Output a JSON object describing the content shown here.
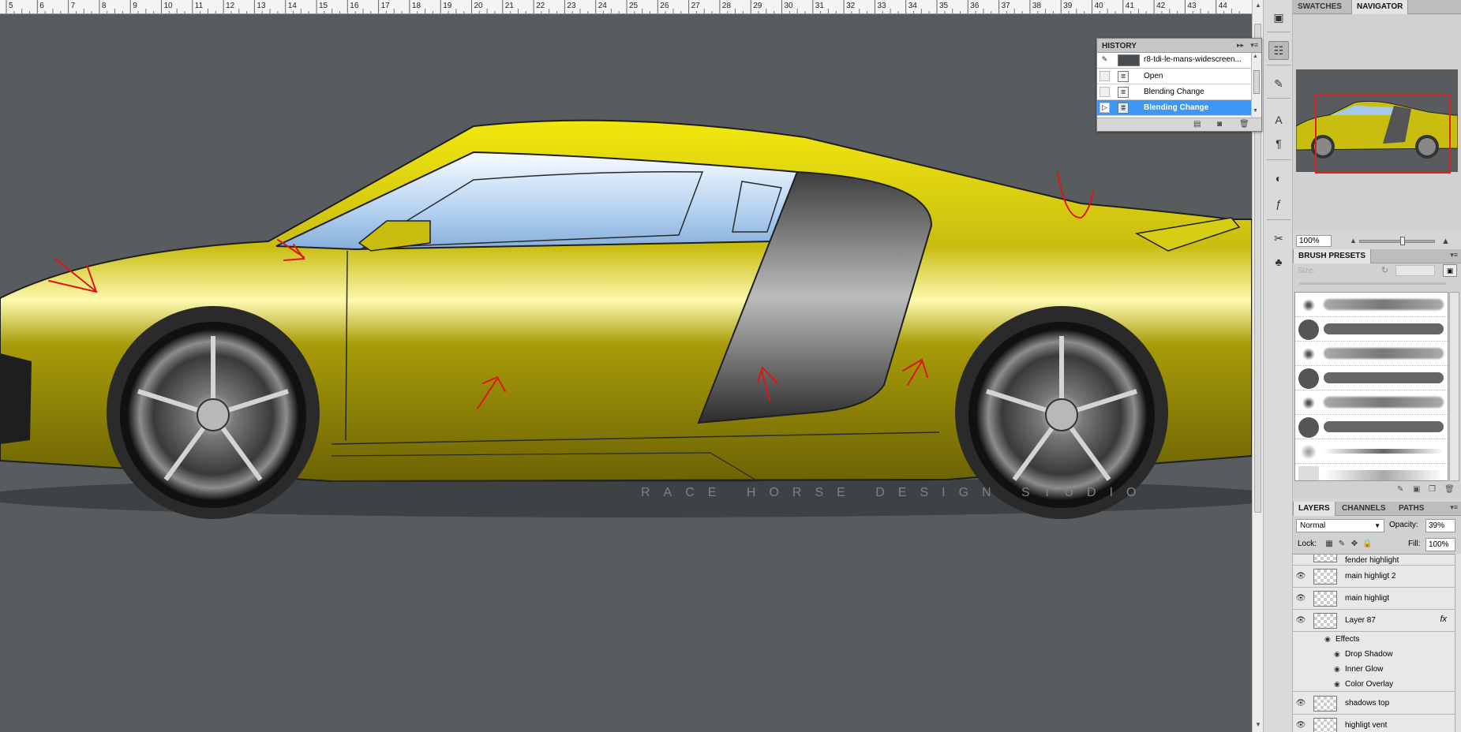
{
  "ruler": {
    "labels": [
      "5",
      "6",
      "7",
      "8",
      "9",
      "10",
      "11",
      "12",
      "13",
      "14",
      "15",
      "16",
      "17",
      "18",
      "19",
      "20",
      "21",
      "22",
      "23",
      "24",
      "25",
      "26",
      "27",
      "28",
      "29",
      "30",
      "31",
      "32",
      "33",
      "34",
      "35",
      "36",
      "37",
      "38",
      "39",
      "40",
      "41",
      "42",
      "43",
      "44"
    ]
  },
  "canvas": {
    "watermark": "RACE HORSE DESIGN STUDIO",
    "car_color": "#c9bd10",
    "background_color": "#595c5f",
    "annotation_color": "#e01414"
  },
  "tools": {
    "icons": [
      "mini-bridge-icon",
      "history-panel-icon",
      "brush-icon",
      "character-icon",
      "paragraph-icon",
      "swatch-palette-icon",
      "styles-icon",
      "tools-icon",
      "clone-stamp-icon"
    ]
  },
  "panels": {
    "top_tabs": [
      "SWATCHES",
      "NAVIGATOR"
    ],
    "active_top_tab": "NAVIGATOR",
    "navigator": {
      "zoom": "100%"
    },
    "brush_presets": {
      "tab": "BRUSH PRESETS",
      "size_label": "Size:"
    },
    "layers": {
      "tabs": [
        "LAYERS",
        "CHANNELS",
        "PATHS"
      ],
      "blend_mode": "Normal",
      "opacity_label": "Opacity:",
      "opacity": "39%",
      "lock_label": "Lock:",
      "fill_label": "Fill:",
      "fill": "100%",
      "items": [
        {
          "name": "fender highlight"
        },
        {
          "name": "main highligt 2"
        },
        {
          "name": "main highligt"
        },
        {
          "name": "Layer 87",
          "fx": "fx"
        },
        {
          "name": "shadows top"
        },
        {
          "name": "highligt vent"
        }
      ],
      "effects_label": "Effects",
      "effects": [
        "Drop Shadow",
        "Inner Glow",
        "Color Overlay"
      ]
    }
  },
  "history": {
    "title": "HISTORY",
    "snapshot": "r8-tdi-le-mans-widescreen...",
    "items": [
      {
        "label": "Open",
        "selected": false
      },
      {
        "label": "Blending Change",
        "selected": false
      },
      {
        "label": "Blending Change",
        "selected": true
      }
    ]
  }
}
